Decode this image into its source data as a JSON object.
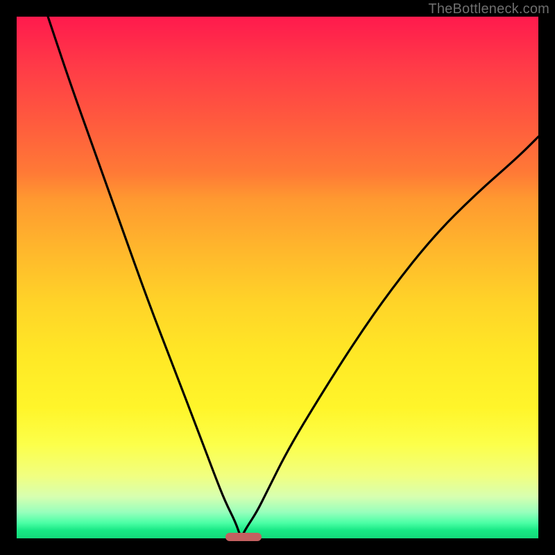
{
  "watermark": "TheBottleneck.com",
  "colors": {
    "background": "#000000",
    "gradient_top": "#ff1a4d",
    "gradient_mid": "#ffe826",
    "gradient_bottom": "#13d87a",
    "curve": "#000000",
    "marker": "#c36060"
  },
  "chart_data": {
    "type": "line",
    "title": "",
    "xlabel": "",
    "ylabel": "",
    "xlim": [
      0,
      100
    ],
    "ylim": [
      0,
      100
    ],
    "grid": false,
    "legend": false,
    "notes": "No axis ticks or numeric labels are shown. Chart is a V-shaped bottleneck curve with vertical gradient background (red=high, green=low). Minimum of the curve (optimal point) sits around x≈43 at y≈0, marked by a rounded horizontal bar.",
    "series": [
      {
        "name": "bottleneck-curve",
        "x": [
          6,
          10,
          15,
          20,
          25,
          30,
          35,
          38,
          40,
          42,
          43,
          44,
          46,
          48,
          52,
          58,
          65,
          72,
          80,
          88,
          96,
          100
        ],
        "y": [
          100,
          88,
          74,
          60,
          46,
          33,
          20,
          12,
          7,
          3,
          0,
          2,
          5,
          9,
          17,
          27,
          38,
          48,
          58,
          66,
          73,
          77
        ]
      }
    ],
    "marker": {
      "name": "optimal-range",
      "x_start": 40,
      "x_end": 47,
      "y": 0
    }
  }
}
